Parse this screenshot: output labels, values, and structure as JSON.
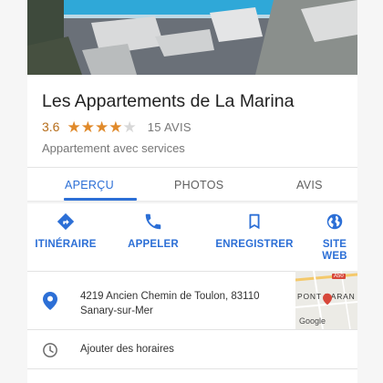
{
  "place": {
    "name": "Les Appartements de La Marina",
    "rating": "3.6",
    "rating_value": 3.6,
    "reviews_label": "15 AVIS",
    "category": "Appartement avec services"
  },
  "tabs": [
    {
      "label": "APERÇU",
      "active": true
    },
    {
      "label": "PHOTOS",
      "active": false
    },
    {
      "label": "AVIS",
      "active": false
    }
  ],
  "actions": [
    {
      "label": "ITINÉRAIRE",
      "icon": "directions-icon"
    },
    {
      "label": "APPELER",
      "icon": "phone-icon"
    },
    {
      "label": "ENREGISTRER",
      "icon": "bookmark-icon"
    },
    {
      "label": "SITE WEB",
      "icon": "globe-icon"
    }
  ],
  "address": {
    "line1": "4219 Ancien Chemin de Toulon, 83110",
    "line2": "Sanary-sur-Mer",
    "icon": "location-pin-icon"
  },
  "minimap": {
    "road_shield": "A50",
    "label": "PONT DARAN",
    "logo": "Google"
  },
  "hours": {
    "label": "Ajouter des horaires",
    "icon": "clock-icon"
  },
  "colors": {
    "accent": "#2c6fd6",
    "star": "#e08a2b",
    "rating_text": "#b66d1a",
    "secondary_text": "#777777"
  }
}
